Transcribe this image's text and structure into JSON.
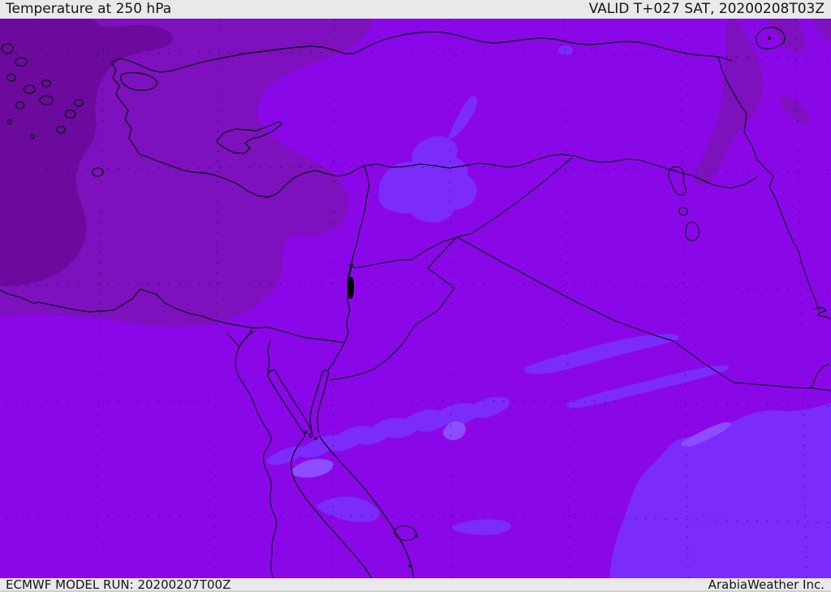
{
  "header": {
    "title": "Temperature at 250 hPa",
    "valid_label": "VALID T+027 SAT, 20200208T03Z"
  },
  "footer": {
    "model_run": "ECMWF MODEL RUN: 20200207T00Z",
    "credit": "ArabiaWeather Inc."
  },
  "map": {
    "parameter": "Temperature at 250 hPa",
    "model": "ECMWF",
    "colors": {
      "header_bg": "#E9E9E9",
      "text_color": "#151515",
      "line_color": "#000000",
      "band1": "#6C0A9E",
      "band2": "#7D11BD",
      "band3": "#8A08E8",
      "band4": "#7B2BFA",
      "band5": "#8A4DFF"
    },
    "temperature_bands": [
      {
        "shade": "darkest purple (coldest shown)",
        "hex": "#6C0A9E",
        "location": "northwest corner / Aegean"
      },
      {
        "shade": "dark purple",
        "hex": "#7D11BD",
        "location": "Turkey, east Mediterranean, northeast corner"
      },
      {
        "shade": "bright purple (dominant)",
        "hex": "#8A08E8",
        "location": "most of map"
      },
      {
        "shade": "light blue-violet",
        "hex": "#7B2BFA",
        "location": "Syria patch, Sinai-Saudi diagonal band, southeast corner"
      },
      {
        "shade": "lightest violet",
        "hex": "#8A4DFF",
        "location": "small streaks inside light band"
      }
    ],
    "features": [
      "Aegean islands",
      "Turkey coastline",
      "Black Sea coast",
      "Cyprus",
      "Levant coast",
      "Nile Delta",
      "Nile River",
      "Suez Canal",
      "Sinai Peninsula",
      "Gulf of Suez",
      "Gulf of Aqaba",
      "Red Sea",
      "Dead Sea",
      "Sea of Galilee",
      "Lake Urmia",
      "Persian Gulf head",
      "country borders",
      "latitude-longitude graticule dots"
    ]
  }
}
